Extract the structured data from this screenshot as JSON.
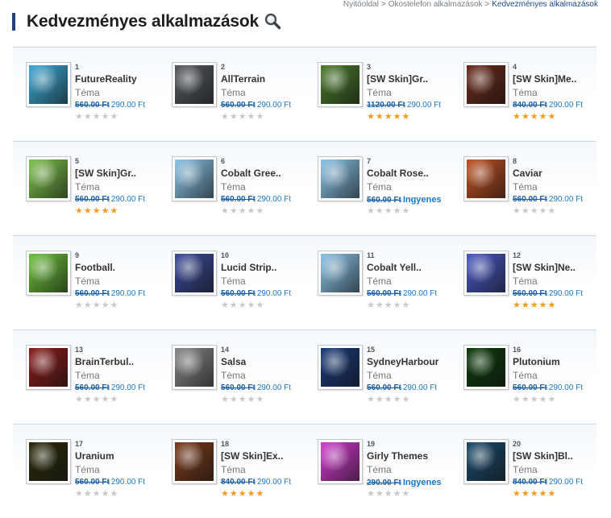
{
  "breadcrumb": [
    "Nyitóoldal",
    "Okostelefon alkalmazások",
    "Kedvezményes alkalmazások"
  ],
  "breadcrumb_sep": ">",
  "page_title": "Kedvezményes alkalmazások",
  "items": [
    {
      "rank": "1",
      "name": "FutureReality",
      "type": "Téma",
      "old_price": "560.00 Ft",
      "new_price": "290.00 Ft",
      "rating": 0,
      "thumb": "#3aa9d6"
    },
    {
      "rank": "2",
      "name": "AllTerrain",
      "type": "Téma",
      "old_price": "560.00 Ft",
      "new_price": "290.00 Ft",
      "rating": 0,
      "thumb": "#555a60"
    },
    {
      "rank": "3",
      "name": "[SW Skin]Gr..",
      "type": "Téma",
      "old_price": "1120.00 Ft",
      "new_price": "290.00 Ft",
      "rating": 5,
      "thumb": "#4a7a2a"
    },
    {
      "rank": "4",
      "name": "[SW Skin]Me..",
      "type": "Téma",
      "old_price": "840.00 Ft",
      "new_price": "290.00 Ft",
      "rating": 5,
      "thumb": "#6a2a18"
    },
    {
      "rank": "5",
      "name": "[SW Skin]Gr..",
      "type": "Téma",
      "old_price": "560.00 Ft",
      "new_price": "290.00 Ft",
      "rating": 5,
      "thumb": "#7cc24a"
    },
    {
      "rank": "6",
      "name": "Cobalt Gree..",
      "type": "Téma",
      "old_price": "560.00 Ft",
      "new_price": "290.00 Ft",
      "rating": 0,
      "thumb": "#8ac4e8"
    },
    {
      "rank": "7",
      "name": "Cobalt Rose..",
      "type": "Téma",
      "old_price": "560.00 Ft",
      "new_price": "Ingyenes",
      "rating": 0,
      "thumb": "#8ac4e8"
    },
    {
      "rank": "8",
      "name": "Caviar",
      "type": "Téma",
      "old_price": "560.00 Ft",
      "new_price": "290.00 Ft",
      "rating": 0,
      "thumb": "#c05020"
    },
    {
      "rank": "9",
      "name": "Football.",
      "type": "Téma",
      "old_price": "560.00 Ft",
      "new_price": "290.00 Ft",
      "rating": 0,
      "thumb": "#6cc23a"
    },
    {
      "rank": "10",
      "name": "Lucid Strip..",
      "type": "Téma",
      "old_price": "560.00 Ft",
      "new_price": "290.00 Ft",
      "rating": 0,
      "thumb": "#3a4a9a"
    },
    {
      "rank": "11",
      "name": "Cobalt Yell..",
      "type": "Téma",
      "old_price": "560.00 Ft",
      "new_price": "290.00 Ft",
      "rating": 0,
      "thumb": "#8ac4e8"
    },
    {
      "rank": "12",
      "name": "[SW Skin]Ne..",
      "type": "Téma",
      "old_price": "560.00 Ft",
      "new_price": "290.00 Ft",
      "rating": 5,
      "thumb": "#4a58c8"
    },
    {
      "rank": "13",
      "name": "BrainTerbul..",
      "type": "Téma",
      "old_price": "560.00 Ft",
      "new_price": "290.00 Ft",
      "rating": 0,
      "thumb": "#8a1a1a"
    },
    {
      "rank": "14",
      "name": "Salsa",
      "type": "Téma",
      "old_price": "560.00 Ft",
      "new_price": "290.00 Ft",
      "rating": 0,
      "thumb": "#888888"
    },
    {
      "rank": "15",
      "name": "SydneyHarbour",
      "type": "Téma",
      "old_price": "560.00 Ft",
      "new_price": "290.00 Ft",
      "rating": 0,
      "thumb": "#1a3a7a"
    },
    {
      "rank": "16",
      "name": "Plutonium",
      "type": "Téma",
      "old_price": "560.00 Ft",
      "new_price": "290.00 Ft",
      "rating": 0,
      "thumb": "#0a3a0a"
    },
    {
      "rank": "17",
      "name": "Uranium",
      "type": "Téma",
      "old_price": "560.00 Ft",
      "new_price": "290.00 Ft",
      "rating": 0,
      "thumb": "#2a2a0a"
    },
    {
      "rank": "18",
      "name": "[SW Skin]Ex..",
      "type": "Téma",
      "old_price": "840.00 Ft",
      "new_price": "290.00 Ft",
      "rating": 5,
      "thumb": "#7a3a1a"
    },
    {
      "rank": "19",
      "name": "Girly Themes",
      "type": "Téma",
      "old_price": "290.00 Ft",
      "new_price": "Ingyenes",
      "rating": 0,
      "thumb": "#d43ad0"
    },
    {
      "rank": "20",
      "name": "[SW Skin]Bl..",
      "type": "Téma",
      "old_price": "840.00 Ft",
      "new_price": "290.00 Ft",
      "rating": 5,
      "thumb": "#1a4a6a"
    }
  ]
}
